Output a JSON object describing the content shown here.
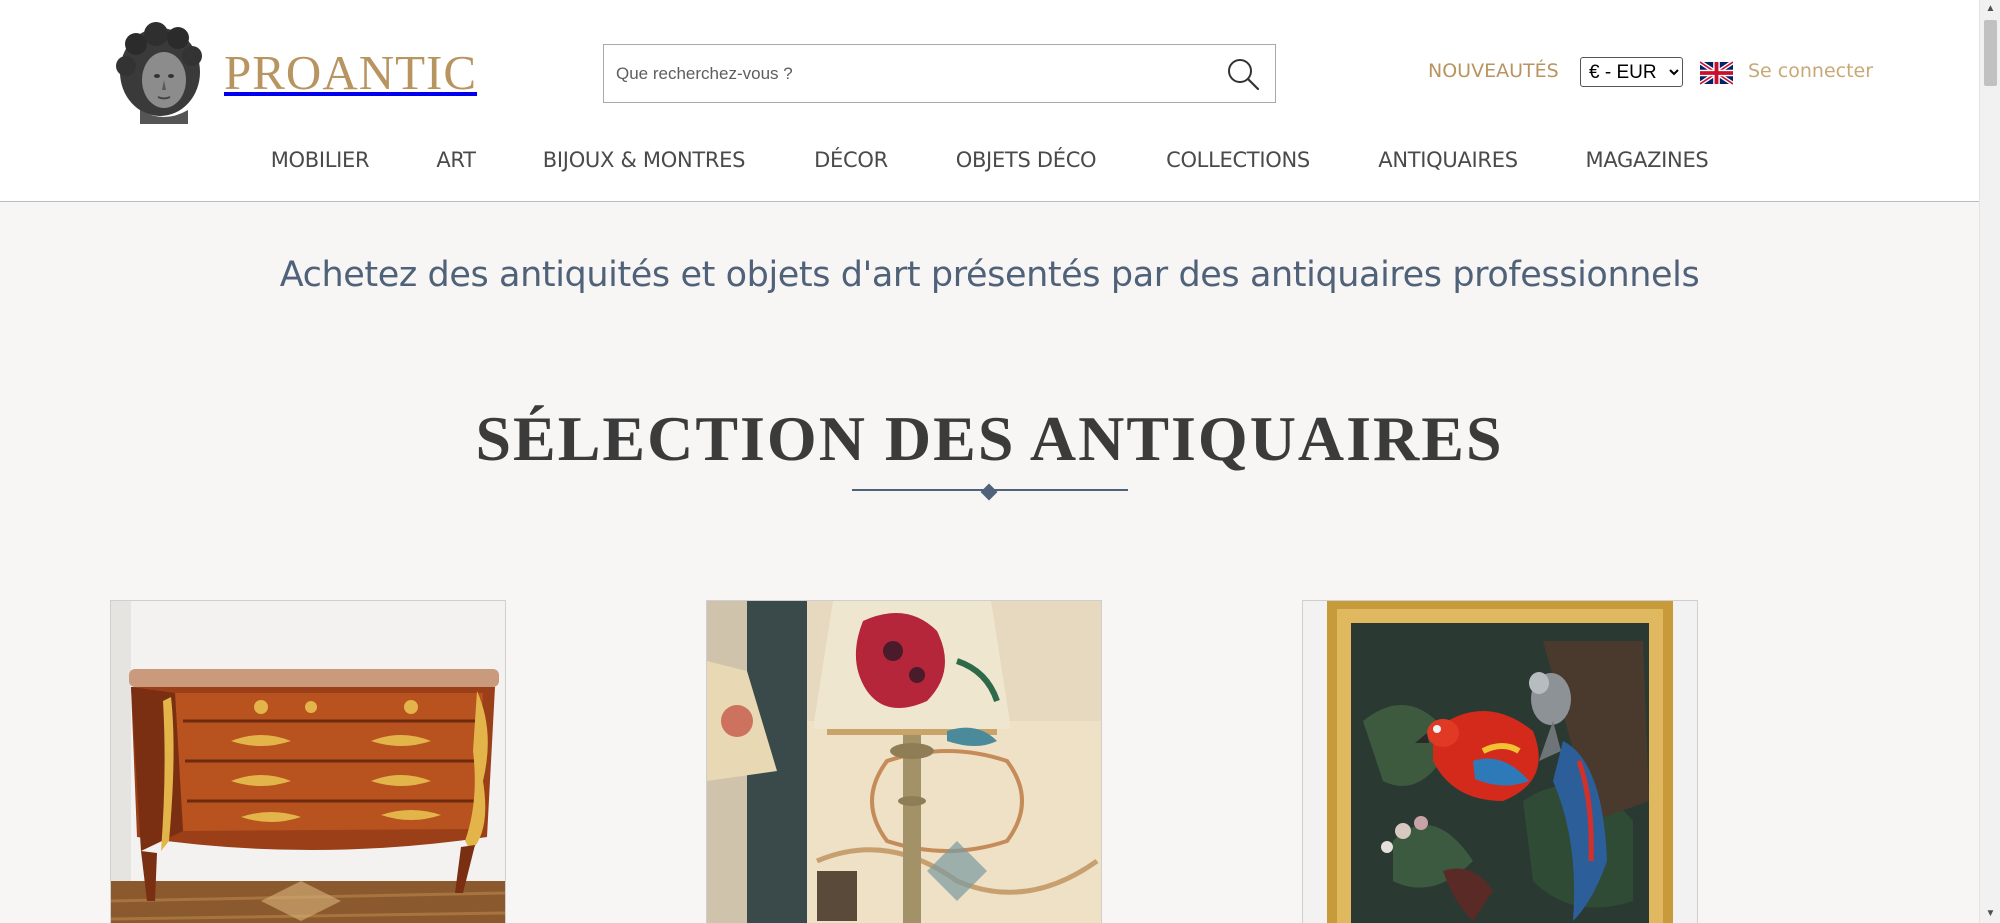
{
  "brand": {
    "name": "PROANTIC"
  },
  "search": {
    "placeholder": "Que recherchez-vous ?"
  },
  "header": {
    "new_label": "NOUVEAUTÉS",
    "currency_selected": "€ - EUR",
    "login_label": "Se connecter"
  },
  "nav": {
    "items": [
      {
        "label": "MOBILIER"
      },
      {
        "label": "ART"
      },
      {
        "label": "BIJOUX & MONTRES"
      },
      {
        "label": "DÉCOR"
      },
      {
        "label": "OBJETS DÉCO"
      },
      {
        "label": "COLLECTIONS"
      },
      {
        "label": "ANTIQUAIRES"
      },
      {
        "label": "MAGAZINES"
      }
    ]
  },
  "main": {
    "tagline": "Achetez des antiquités et objets d'art présentés par des antiquaires professionnels",
    "section_title": "SÉLECTION DES ANTIQUAIRES"
  },
  "colors": {
    "brand_gold": "#b89460",
    "accent_blue": "#4f627a",
    "page_bg": "#f7f6f4"
  }
}
